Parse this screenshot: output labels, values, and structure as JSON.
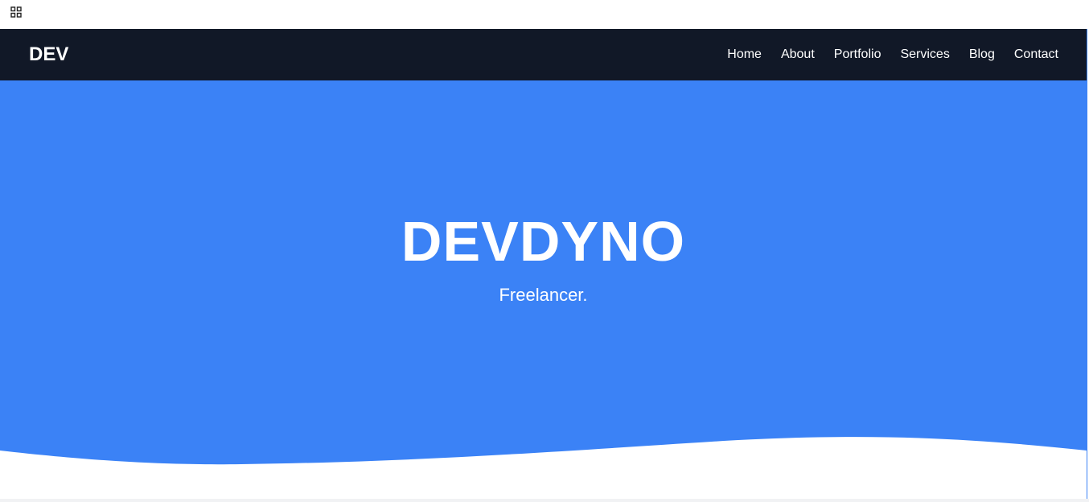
{
  "browser": {
    "apps_icon": "grid-icon"
  },
  "navbar": {
    "brand": "DEV",
    "links": [
      "Home",
      "About",
      "Portfolio",
      "Services",
      "Blog",
      "Contact"
    ]
  },
  "hero": {
    "title": "DEVDYNO",
    "subtitle": "Freelancer."
  },
  "colors": {
    "navbar_bg": "#111827",
    "hero_bg": "#3b82f6",
    "text": "#ffffff",
    "wave": "#ffffff"
  }
}
